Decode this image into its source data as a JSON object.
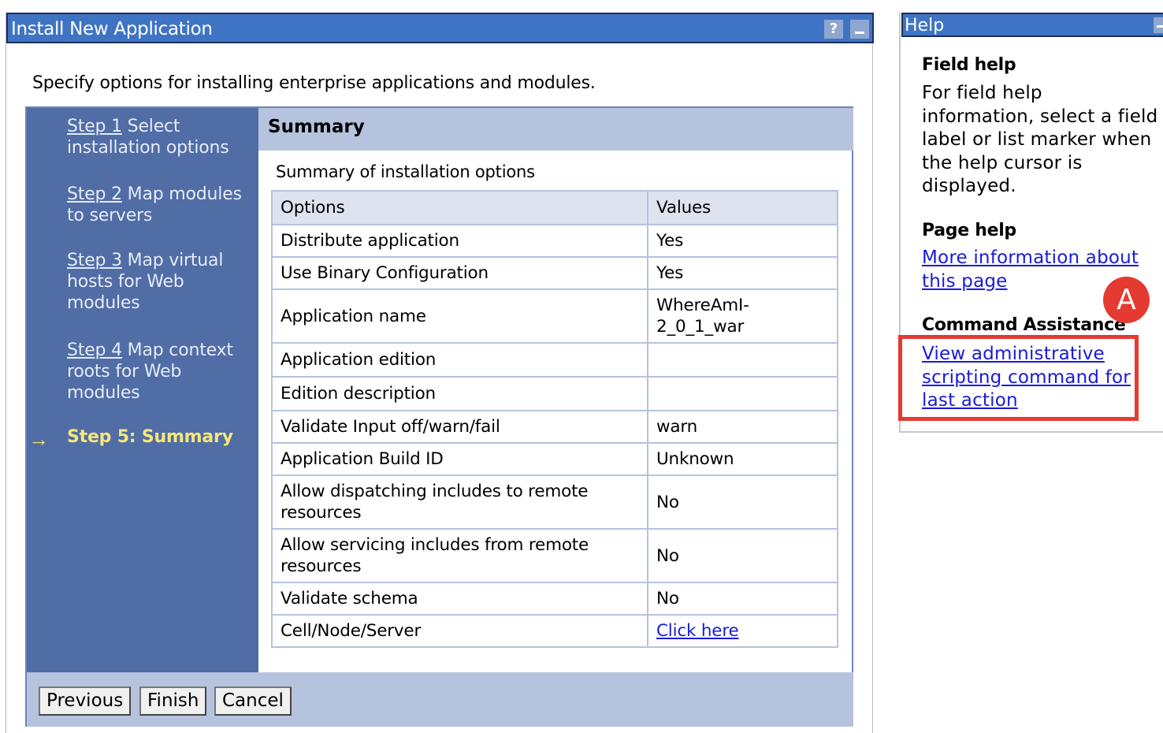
{
  "main": {
    "title": "Install New Application",
    "help_btn": "?",
    "intro": "Specify options for installing enterprise applications and modules."
  },
  "steps": [
    {
      "link": "Step 1",
      "text": " Select installation options",
      "line1": " Select",
      "line2": "installation options"
    },
    {
      "link": "Step 2",
      "line1": " Map modules",
      "line2": "to servers"
    },
    {
      "link": "Step 3",
      "line1": " Map virtual",
      "line2": "hosts for Web",
      "line3": "modules"
    },
    {
      "link": "Step 4",
      "line1": " Map context",
      "line2": "roots for Web",
      "line3": "modules"
    },
    {
      "current": "Step 5: Summary"
    }
  ],
  "content": {
    "title": "Summary",
    "caption": "Summary of installation options",
    "columns": [
      "Options",
      "Values"
    ],
    "rows": [
      {
        "option": "Distribute application",
        "value": "Yes"
      },
      {
        "option": "Use Binary Configuration",
        "value": "Yes"
      },
      {
        "option": "Application name",
        "value_l1": "WhereAmI-",
        "value_l2": "2_0_1_war"
      },
      {
        "option": "Application edition",
        "value": ""
      },
      {
        "option": "Edition description",
        "value": ""
      },
      {
        "option": "Validate Input off/warn/fail",
        "value": "warn"
      },
      {
        "option": "Application Build ID",
        "value": "Unknown"
      },
      {
        "option_l1": "Allow dispatching includes to remote",
        "option_l2": "resources",
        "value": "No"
      },
      {
        "option_l1": "Allow servicing includes from remote",
        "option_l2": "resources",
        "value": "No"
      },
      {
        "option": "Validate schema",
        "value": "No"
      },
      {
        "option": "Cell/Node/Server",
        "value": "Click here"
      }
    ]
  },
  "buttons": {
    "previous": "Previous",
    "finish": "Finish",
    "cancel": "Cancel"
  },
  "help": {
    "title": "Help",
    "field_help_heading": "Field help",
    "field_help_text": "For field help information, select a field label or list marker when the help cursor is displayed.",
    "page_help_heading": "Page help",
    "page_help_link_l1": "More information about",
    "page_help_link_l2": "this page",
    "command_heading": "Command Assistance",
    "command_link_l1": "View administrative",
    "command_link_l2": "scripting command for",
    "command_link_l3": "last action"
  },
  "annotation": {
    "badge": "A",
    "color": "#e53a31"
  },
  "colors": {
    "titlebar": "#3f74c4",
    "steps_bg": "#506da6",
    "current_step": "#f5e77a",
    "header_bg": "#b5c3de",
    "link": "#1a1adb"
  }
}
